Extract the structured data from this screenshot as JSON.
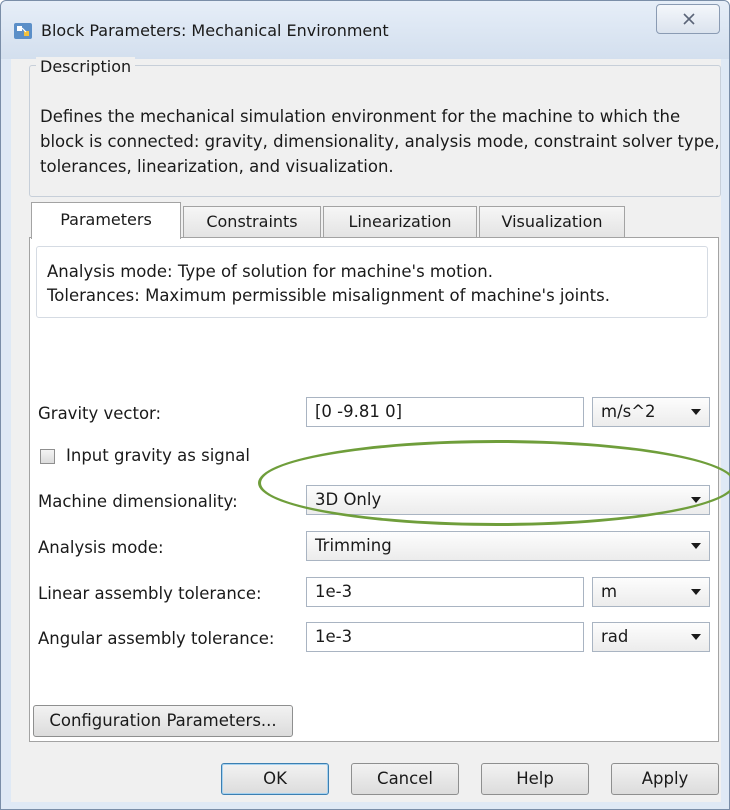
{
  "window": {
    "title": "Block Parameters: Mechanical Environment",
    "close_icon": "close-icon"
  },
  "description": {
    "legend": "Description",
    "text": "Defines the mechanical simulation environment for the machine to which the block is connected: gravity, dimensionality, analysis mode, constraint solver type, tolerances, linearization, and visualization."
  },
  "tabs": [
    {
      "label": "Parameters",
      "active": true
    },
    {
      "label": "Constraints",
      "active": false
    },
    {
      "label": "Linearization",
      "active": false
    },
    {
      "label": "Visualization",
      "active": false
    }
  ],
  "hint": {
    "line1": "Analysis mode: Type of solution for machine's motion.",
    "line2": "Tolerances: Maximum permissible misalignment of machine's joints."
  },
  "params": {
    "gravity_label": "Gravity vector:",
    "gravity_value": "[0 -9.81 0]",
    "gravity_unit": "m/s^2",
    "input_gravity_label": "Input gravity as signal",
    "input_gravity_checked": false,
    "dimensionality_label": "Machine dimensionality:",
    "dimensionality_value": "3D Only",
    "analysis_label": "Analysis mode:",
    "analysis_value": "Trimming",
    "linear_tol_label": "Linear assembly tolerance:",
    "linear_tol_value": "1e-3",
    "linear_tol_unit": "m",
    "angular_tol_label": "Angular assembly tolerance:",
    "angular_tol_value": "1e-3",
    "angular_tol_unit": "rad"
  },
  "buttons": {
    "config": "Configuration Parameters...",
    "ok": "OK",
    "cancel": "Cancel",
    "help": "Help",
    "apply": "Apply"
  },
  "colors": {
    "highlight": "#6f9e3b",
    "window_frame": "#dfe9f5"
  }
}
